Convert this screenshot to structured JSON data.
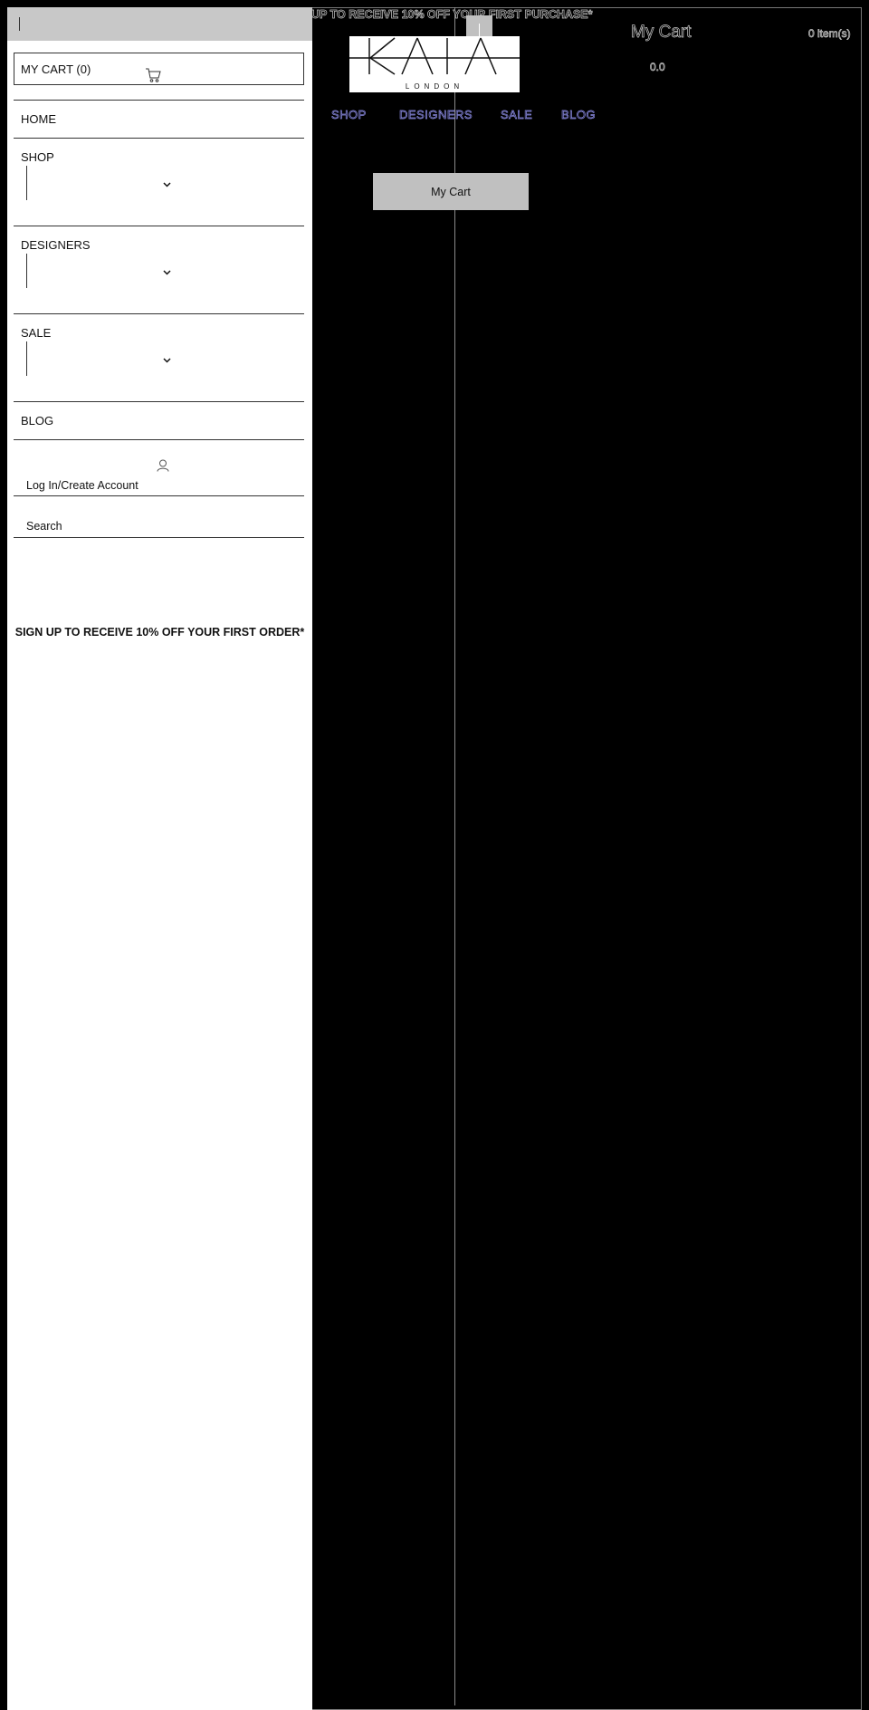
{
  "announcement": "UP TO RECEIVE 10% OFF YOUR FIRST PURCHASE*",
  "logo": {
    "wordmark": "KAIA",
    "subtitle": "LONDON"
  },
  "cart_drawer": {
    "title": "My Cart",
    "count_text": "0 item(s)",
    "empty_text": "0.0"
  },
  "main_nav": {
    "items": [
      {
        "label": "SHOP"
      },
      {
        "label": "DESIGNERS"
      },
      {
        "label": "SALE"
      },
      {
        "label": "BLOG"
      }
    ]
  },
  "my_cart_button": "My Cart",
  "drawer": {
    "cart_label": "MY CART (0)",
    "nav": [
      {
        "label": "HOME"
      },
      {
        "label": "SHOP"
      },
      {
        "label": "DESIGNERS"
      },
      {
        "label": "SALE"
      },
      {
        "label": "BLOG"
      }
    ],
    "account_label": "Log In/Create Account",
    "search_label": "Search",
    "signup_text": "SIGN UP TO RECEIVE 10% OFF YOUR FIRST ORDER*"
  },
  "colors": {
    "background": "#000000",
    "drawer_background": "#ffffff",
    "topbar_grey": "#c8c8c8",
    "nav_link_outline": "#8e8ee8",
    "button_grey": "#c0c0c0"
  },
  "icons": [
    "close-icon",
    "cart-icon",
    "chevron-down-icon",
    "user-icon"
  ]
}
